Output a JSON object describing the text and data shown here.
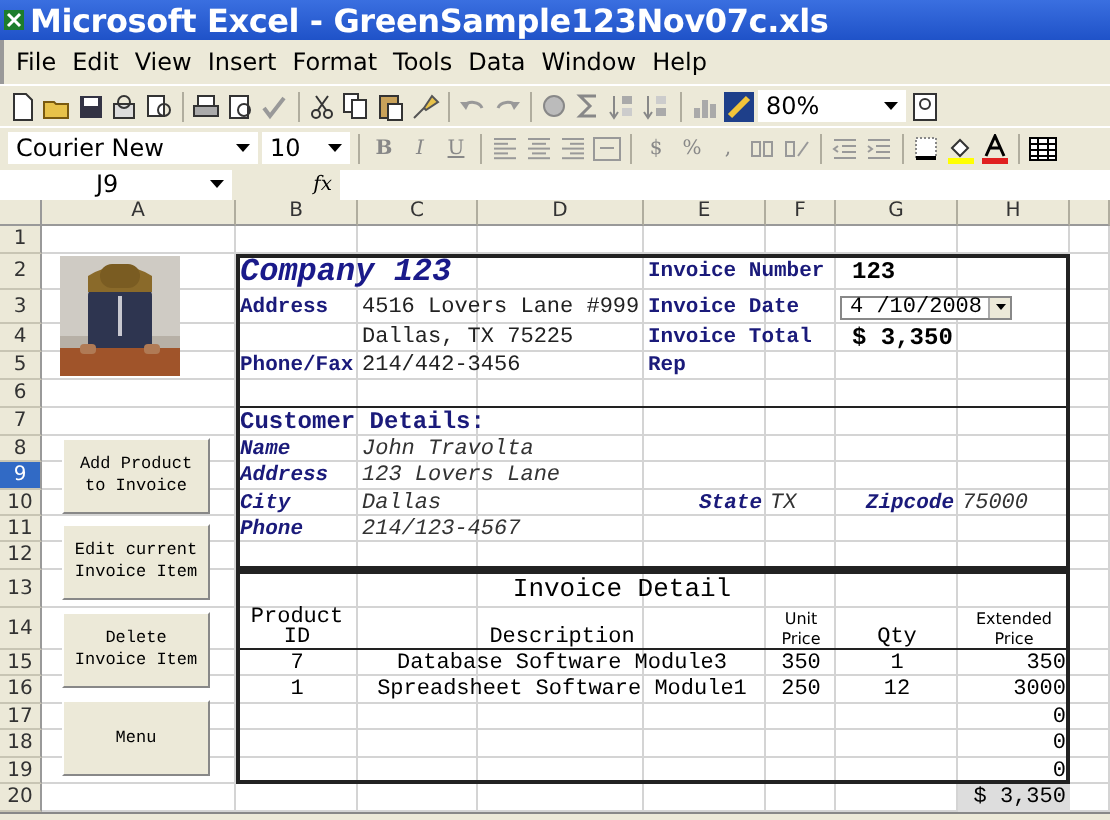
{
  "window": {
    "title": "Microsoft Excel - GreenSample123Nov07c.xls"
  },
  "menu": [
    "File",
    "Edit",
    "View",
    "Insert",
    "Format",
    "Tools",
    "Data",
    "Window",
    "Help"
  ],
  "toolbar": {
    "zoom": "80%"
  },
  "format_toolbar": {
    "font": "Courier New",
    "size": "10",
    "style_buttons": [
      "B",
      "I",
      "U"
    ],
    "number_buttons": [
      "$",
      "%",
      ","
    ]
  },
  "formula_bar": {
    "name_box": "J9",
    "fx": "fx"
  },
  "sheet": {
    "columns": [
      {
        "label": "A",
        "selected": false
      },
      {
        "label": "B",
        "selected": false
      },
      {
        "label": "C",
        "selected": false
      },
      {
        "label": "D",
        "selected": false
      },
      {
        "label": "E",
        "selected": false
      },
      {
        "label": "F",
        "selected": false
      },
      {
        "label": "G",
        "selected": false
      },
      {
        "label": "H",
        "selected": false
      }
    ],
    "rows": [
      {
        "label": "1",
        "selected": false,
        "cells": []
      },
      {
        "label": "2",
        "selected": false,
        "cells": [
          "",
          {
            "kind": "title",
            "text": "Company 123"
          },
          "",
          "",
          {
            "kind": "label",
            "text": "Invoice Number"
          },
          "",
          {
            "kind": "strong",
            "text": "123"
          }
        ]
      },
      {
        "label": "3",
        "selected": false,
        "cells": [
          "",
          {
            "kind": "label",
            "text": "Address"
          },
          {
            "kind": "value",
            "text": "4516 Lovers Lane #999"
          },
          "",
          {
            "kind": "label",
            "text": "Invoice Date"
          },
          "",
          {
            "kind": "dropdown",
            "text": "4 /10/2008"
          }
        ]
      },
      {
        "label": "4",
        "selected": false,
        "cells": [
          "",
          "",
          {
            "kind": "value",
            "text": "Dallas, TX 75225"
          },
          "",
          {
            "kind": "label",
            "text": "Invoice Total"
          },
          "",
          {
            "kind": "strong",
            "text": "$ 3,350"
          }
        ]
      },
      {
        "label": "5",
        "selected": false,
        "cells": [
          "",
          {
            "kind": "label",
            "text": "Phone/Fax"
          },
          {
            "kind": "value",
            "text": "214/442-3456"
          },
          "",
          {
            "kind": "label",
            "text": "Rep"
          }
        ]
      },
      {
        "label": "6",
        "selected": false,
        "cells": []
      },
      {
        "label": "7",
        "selected": false,
        "cells": [
          "",
          {
            "kind": "heading",
            "text": "Customer Details:"
          }
        ]
      },
      {
        "label": "8",
        "selected": false,
        "cells": [
          "",
          {
            "kind": "italic-label",
            "text": "Name"
          },
          {
            "kind": "italic-value",
            "text": "John Travolta"
          }
        ]
      },
      {
        "label": "9",
        "selected": true,
        "cells": [
          "",
          {
            "kind": "italic-label",
            "text": "Address"
          },
          {
            "kind": "italic-value",
            "text": "123 Lovers Lane"
          }
        ]
      },
      {
        "label": "10",
        "selected": false,
        "cells": [
          "",
          {
            "kind": "italic-label",
            "text": "City"
          },
          {
            "kind": "italic-value",
            "text": "Dallas"
          },
          "",
          {
            "kind": "italic-label-right",
            "text": "State"
          },
          {
            "kind": "italic-value",
            "text": "TX"
          },
          {
            "kind": "italic-label-right",
            "text": "Zipcode"
          },
          {
            "kind": "italic-value",
            "text": "75000"
          }
        ]
      },
      {
        "label": "11",
        "selected": false,
        "cells": [
          "",
          {
            "kind": "italic-label",
            "text": "Phone"
          },
          {
            "kind": "italic-value",
            "text": "214/123-4567"
          }
        ]
      },
      {
        "label": "12",
        "selected": false,
        "cells": []
      },
      {
        "label": "13",
        "selected": false,
        "cells": [
          "",
          "",
          "",
          {
            "kind": "table-title",
            "text": "Invoice Detail"
          }
        ]
      },
      {
        "label": "14",
        "selected": false,
        "cells": [
          "",
          {
            "kind": "column-header",
            "text": "Product ID"
          },
          {
            "kind": "wide-header",
            "text": "Description"
          },
          "",
          "",
          {
            "kind": "small-header",
            "text": "Unit Price"
          },
          {
            "kind": "column-header",
            "text": "Qty"
          },
          {
            "kind": "small-header",
            "text": "Extended Price"
          }
        ]
      },
      {
        "label": "15",
        "selected": false,
        "cells": [
          "",
          {
            "kind": "center",
            "text": "7"
          },
          {
            "kind": "wide-center",
            "text": "Database Software Module3"
          },
          "",
          "",
          {
            "kind": "center",
            "text": "350"
          },
          {
            "kind": "center",
            "text": "1"
          },
          {
            "kind": "number",
            "text": "350"
          }
        ]
      },
      {
        "label": "16",
        "selected": false,
        "cells": [
          "",
          {
            "kind": "center",
            "text": "1"
          },
          {
            "kind": "wide-center",
            "text": "Spreadsheet Software Module1"
          },
          "",
          "",
          {
            "kind": "center",
            "text": "250"
          },
          {
            "kind": "center",
            "text": "12"
          },
          {
            "kind": "number",
            "text": "3000"
          }
        ]
      },
      {
        "label": "17",
        "selected": false,
        "cells": [
          "",
          "",
          "",
          "",
          "",
          "",
          "",
          {
            "kind": "number",
            "text": "0"
          }
        ]
      },
      {
        "label": "18",
        "selected": false,
        "cells": [
          "",
          "",
          "",
          "",
          "",
          "",
          "",
          {
            "kind": "number",
            "text": "0"
          }
        ]
      },
      {
        "label": "19",
        "selected": false,
        "cells": [
          "",
          "",
          "",
          "",
          "",
          "",
          "",
          {
            "kind": "number",
            "text": "0"
          }
        ]
      },
      {
        "label": "20",
        "selected": false,
        "cells": [
          "",
          "",
          "",
          "",
          "",
          "",
          "",
          {
            "kind": "total",
            "text": "$ 3,350"
          }
        ]
      }
    ],
    "picture": {
      "kind": "picture"
    },
    "buttons": [
      "Add Product to Invoice",
      "Edit current Invoice Item",
      "Delete Invoice Item",
      "Menu"
    ]
  }
}
